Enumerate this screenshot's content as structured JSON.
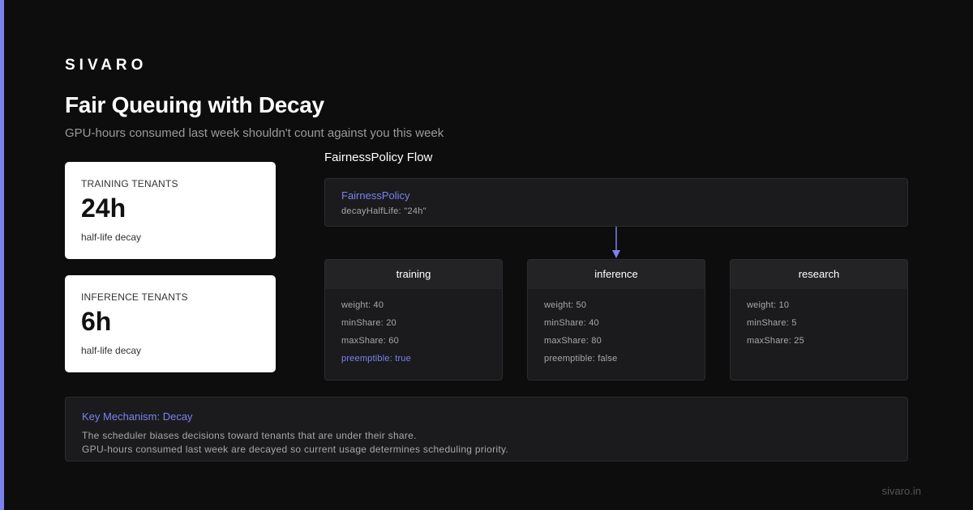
{
  "brand": "SIVARO",
  "title": "Fair Queuing with Decay",
  "subtitle": "GPU-hours consumed last week shouldn't count against you this week",
  "stats": [
    {
      "label": "TRAINING TENANTS",
      "value": "24h",
      "desc": "half-life decay"
    },
    {
      "label": "INFERENCE TENANTS",
      "value": "6h",
      "desc": "half-life decay"
    }
  ],
  "flow": {
    "title": "FairnessPolicy Flow",
    "policy": {
      "name": "FairnessPolicy",
      "detail": "decayHalfLife: \"24h\""
    },
    "tenants": [
      {
        "name": "training",
        "rows": [
          "weight: 40",
          "minShare: 20",
          "maxShare: 60",
          "preemptible: true"
        ]
      },
      {
        "name": "inference",
        "rows": [
          "weight: 50",
          "minShare: 40",
          "maxShare: 80",
          "preemptible: false"
        ]
      },
      {
        "name": "research",
        "rows": [
          "weight: 10",
          "minShare: 5",
          "maxShare: 25"
        ]
      }
    ]
  },
  "mechanism": {
    "title": "Key Mechanism: Decay",
    "line1": "The scheduler biases decisions toward tenants that are under their share.",
    "line2": "GPU-hours consumed last week are decayed so current usage determines scheduling priority."
  },
  "footer": "sivaro.in",
  "colors": {
    "accent": "#7b82f0",
    "background": "#0d0d0d",
    "card": "#1b1b1d"
  }
}
